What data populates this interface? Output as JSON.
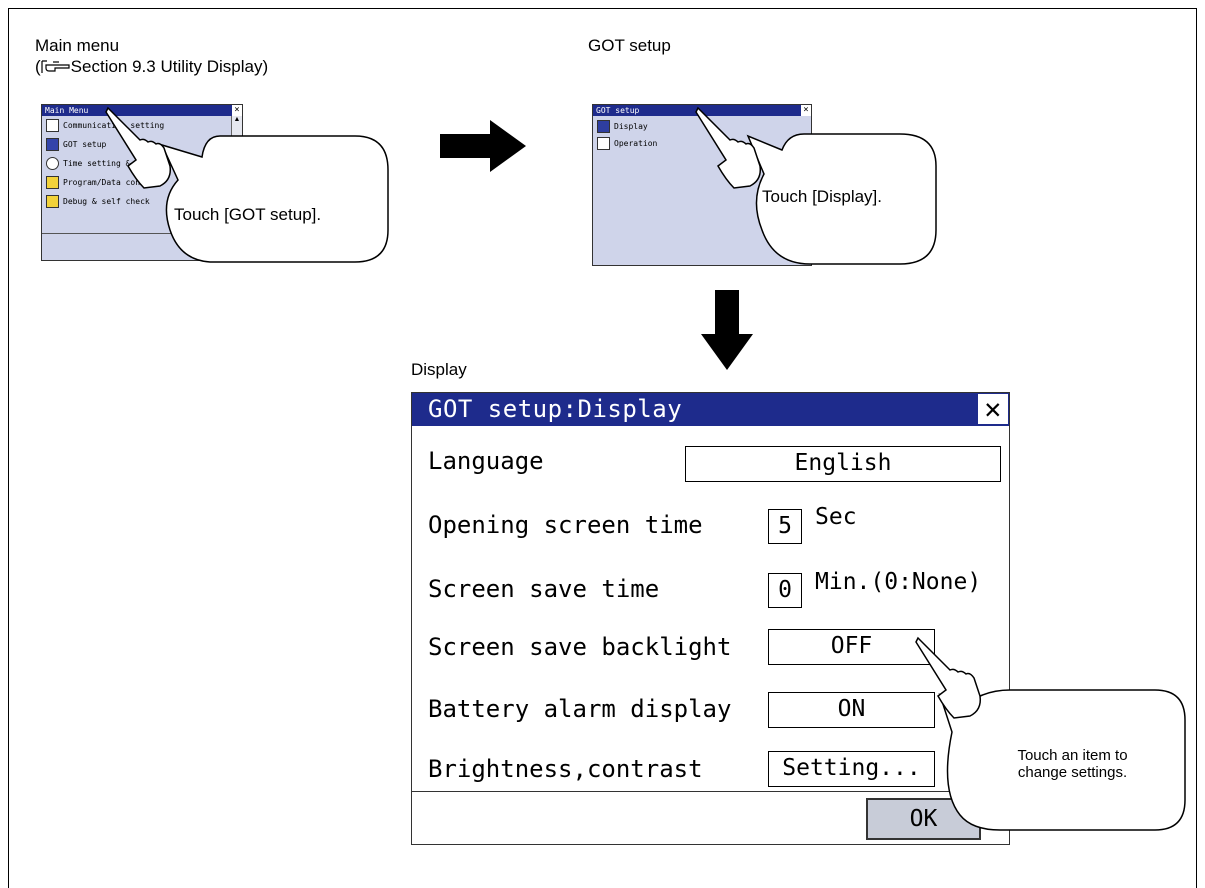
{
  "captions": {
    "main_menu": "Main menu",
    "main_menu_ref": "Section 9.3 Utility Display)",
    "got_setup": "GOT setup",
    "display": "Display"
  },
  "thumb_main_menu": {
    "title": "Main Menu",
    "items": [
      "Communication setting",
      "GOT setup",
      "Time setting & display",
      "Program/Data control",
      "Debug & self check"
    ]
  },
  "thumb_got_setup": {
    "title": "GOT setup",
    "items": [
      "Display",
      "Operation"
    ]
  },
  "callouts": {
    "touch_got_setup": "Touch [GOT setup].",
    "touch_display": "Touch [Display].",
    "touch_item_line1": "Touch an item to",
    "touch_item_line2": "change settings."
  },
  "dialog": {
    "title": "GOT setup:Display",
    "language_label": "Language",
    "language_value": "English",
    "opening_label": "Opening screen time",
    "opening_value": "5",
    "opening_unit": "Sec",
    "save_time_label": "Screen save time",
    "save_time_value": "0",
    "save_time_unit": "Min.(0:None)",
    "backlight_label": "Screen save backlight",
    "backlight_value": "OFF",
    "battery_label": "Battery alarm display",
    "battery_value": "ON",
    "brightness_label": "Brightness,contrast",
    "brightness_value": "Setting...",
    "ok_label": "OK"
  },
  "colors": {
    "titlebar": "#1e2b8c",
    "screen_bg": "#cfd4ea",
    "ok_button": "#c8ccd8"
  }
}
